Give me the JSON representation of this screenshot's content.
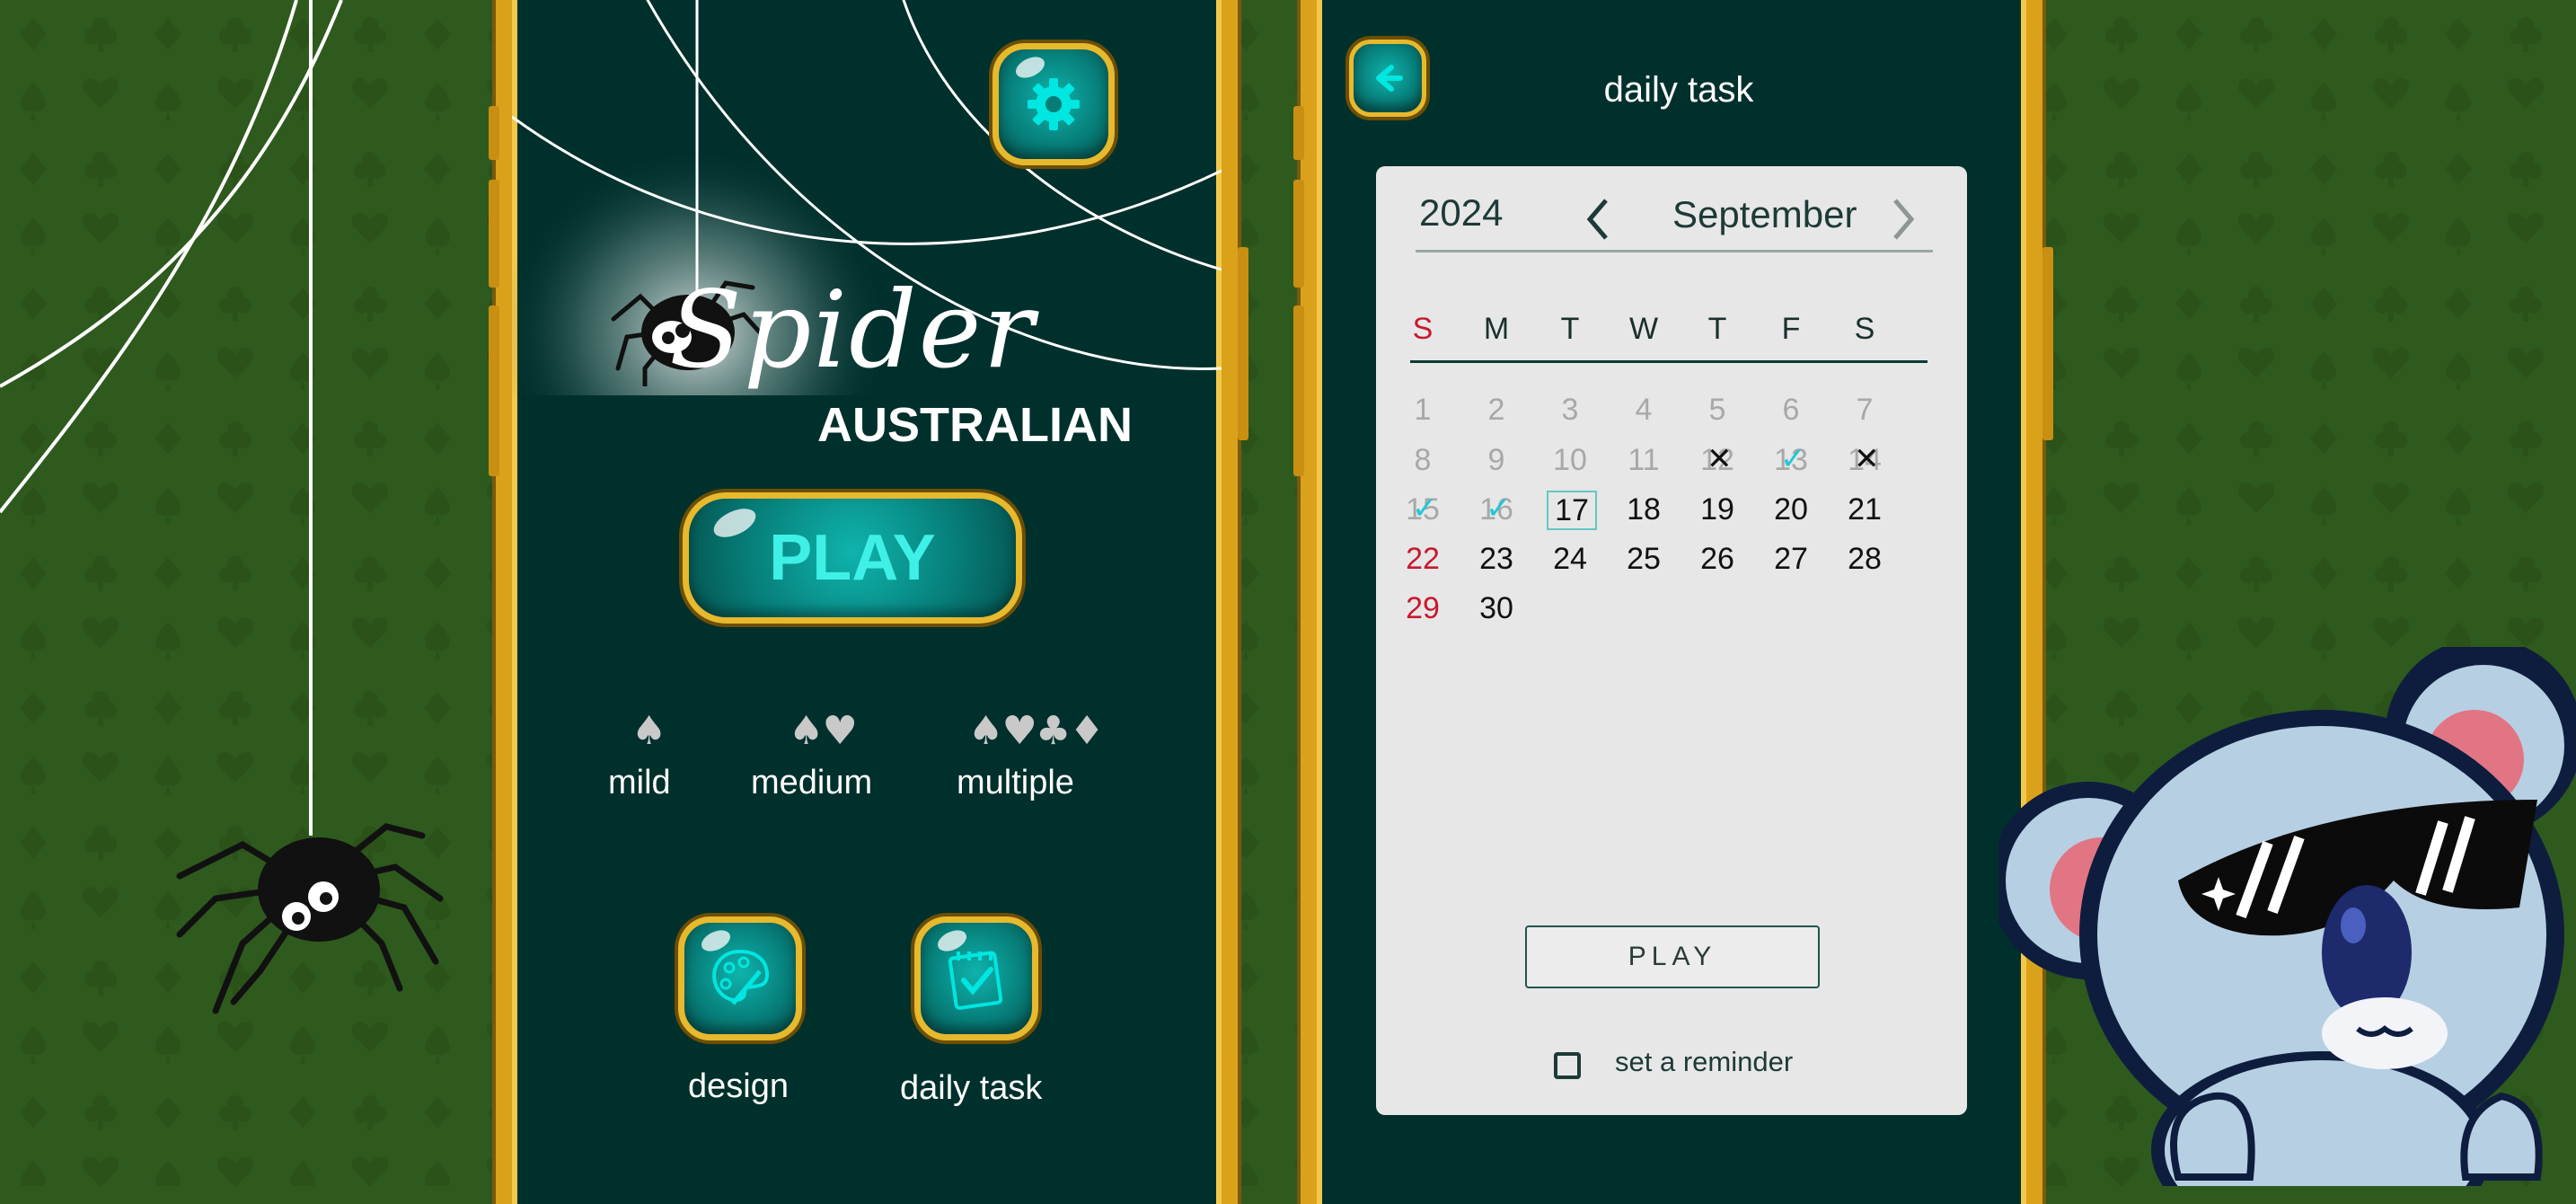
{
  "main_menu": {
    "logo_title": "Spider",
    "logo_subtitle": "AUSTRALIAN",
    "play_label": "PLAY",
    "modes": [
      {
        "suits": "♠",
        "label": "mild"
      },
      {
        "suits": "♠♥",
        "label": "medium"
      },
      {
        "suits": "♠♥♣♦",
        "label": "multiple"
      }
    ],
    "buttons": [
      {
        "icon": "palette-icon",
        "label": "design"
      },
      {
        "icon": "task-checklist-icon",
        "label": "daily task"
      }
    ],
    "settings_icon": "gear-icon"
  },
  "daily_task": {
    "title": "daily task",
    "back_icon": "back-arrow-icon",
    "year": "2024",
    "month": "September",
    "weekdays": [
      "S",
      "M",
      "T",
      "W",
      "T",
      "F",
      "S"
    ],
    "days": [
      "1",
      "2",
      "3",
      "4",
      "5",
      "6",
      "7",
      "8",
      "9",
      "10",
      "11",
      "12",
      "13",
      "14",
      "15",
      "16",
      "17",
      "18",
      "19",
      "20",
      "21",
      "22",
      "23",
      "24",
      "25",
      "26",
      "27",
      "28",
      "29",
      "30"
    ],
    "today": "17",
    "failed_days": [
      "12",
      "14"
    ],
    "completed_days": [
      "13",
      "15",
      "16"
    ],
    "play_label": "PLAY",
    "reminder_label": "set a reminder",
    "reminder_checked": false
  },
  "colors": {
    "felt_green": "#2f5a1e",
    "panel_teal": "#00302c",
    "gold_frame": "#d9a21a",
    "button_teal": "#0a9993",
    "sunday_red": "#c8192f",
    "check_cyan": "#22c7d7"
  }
}
